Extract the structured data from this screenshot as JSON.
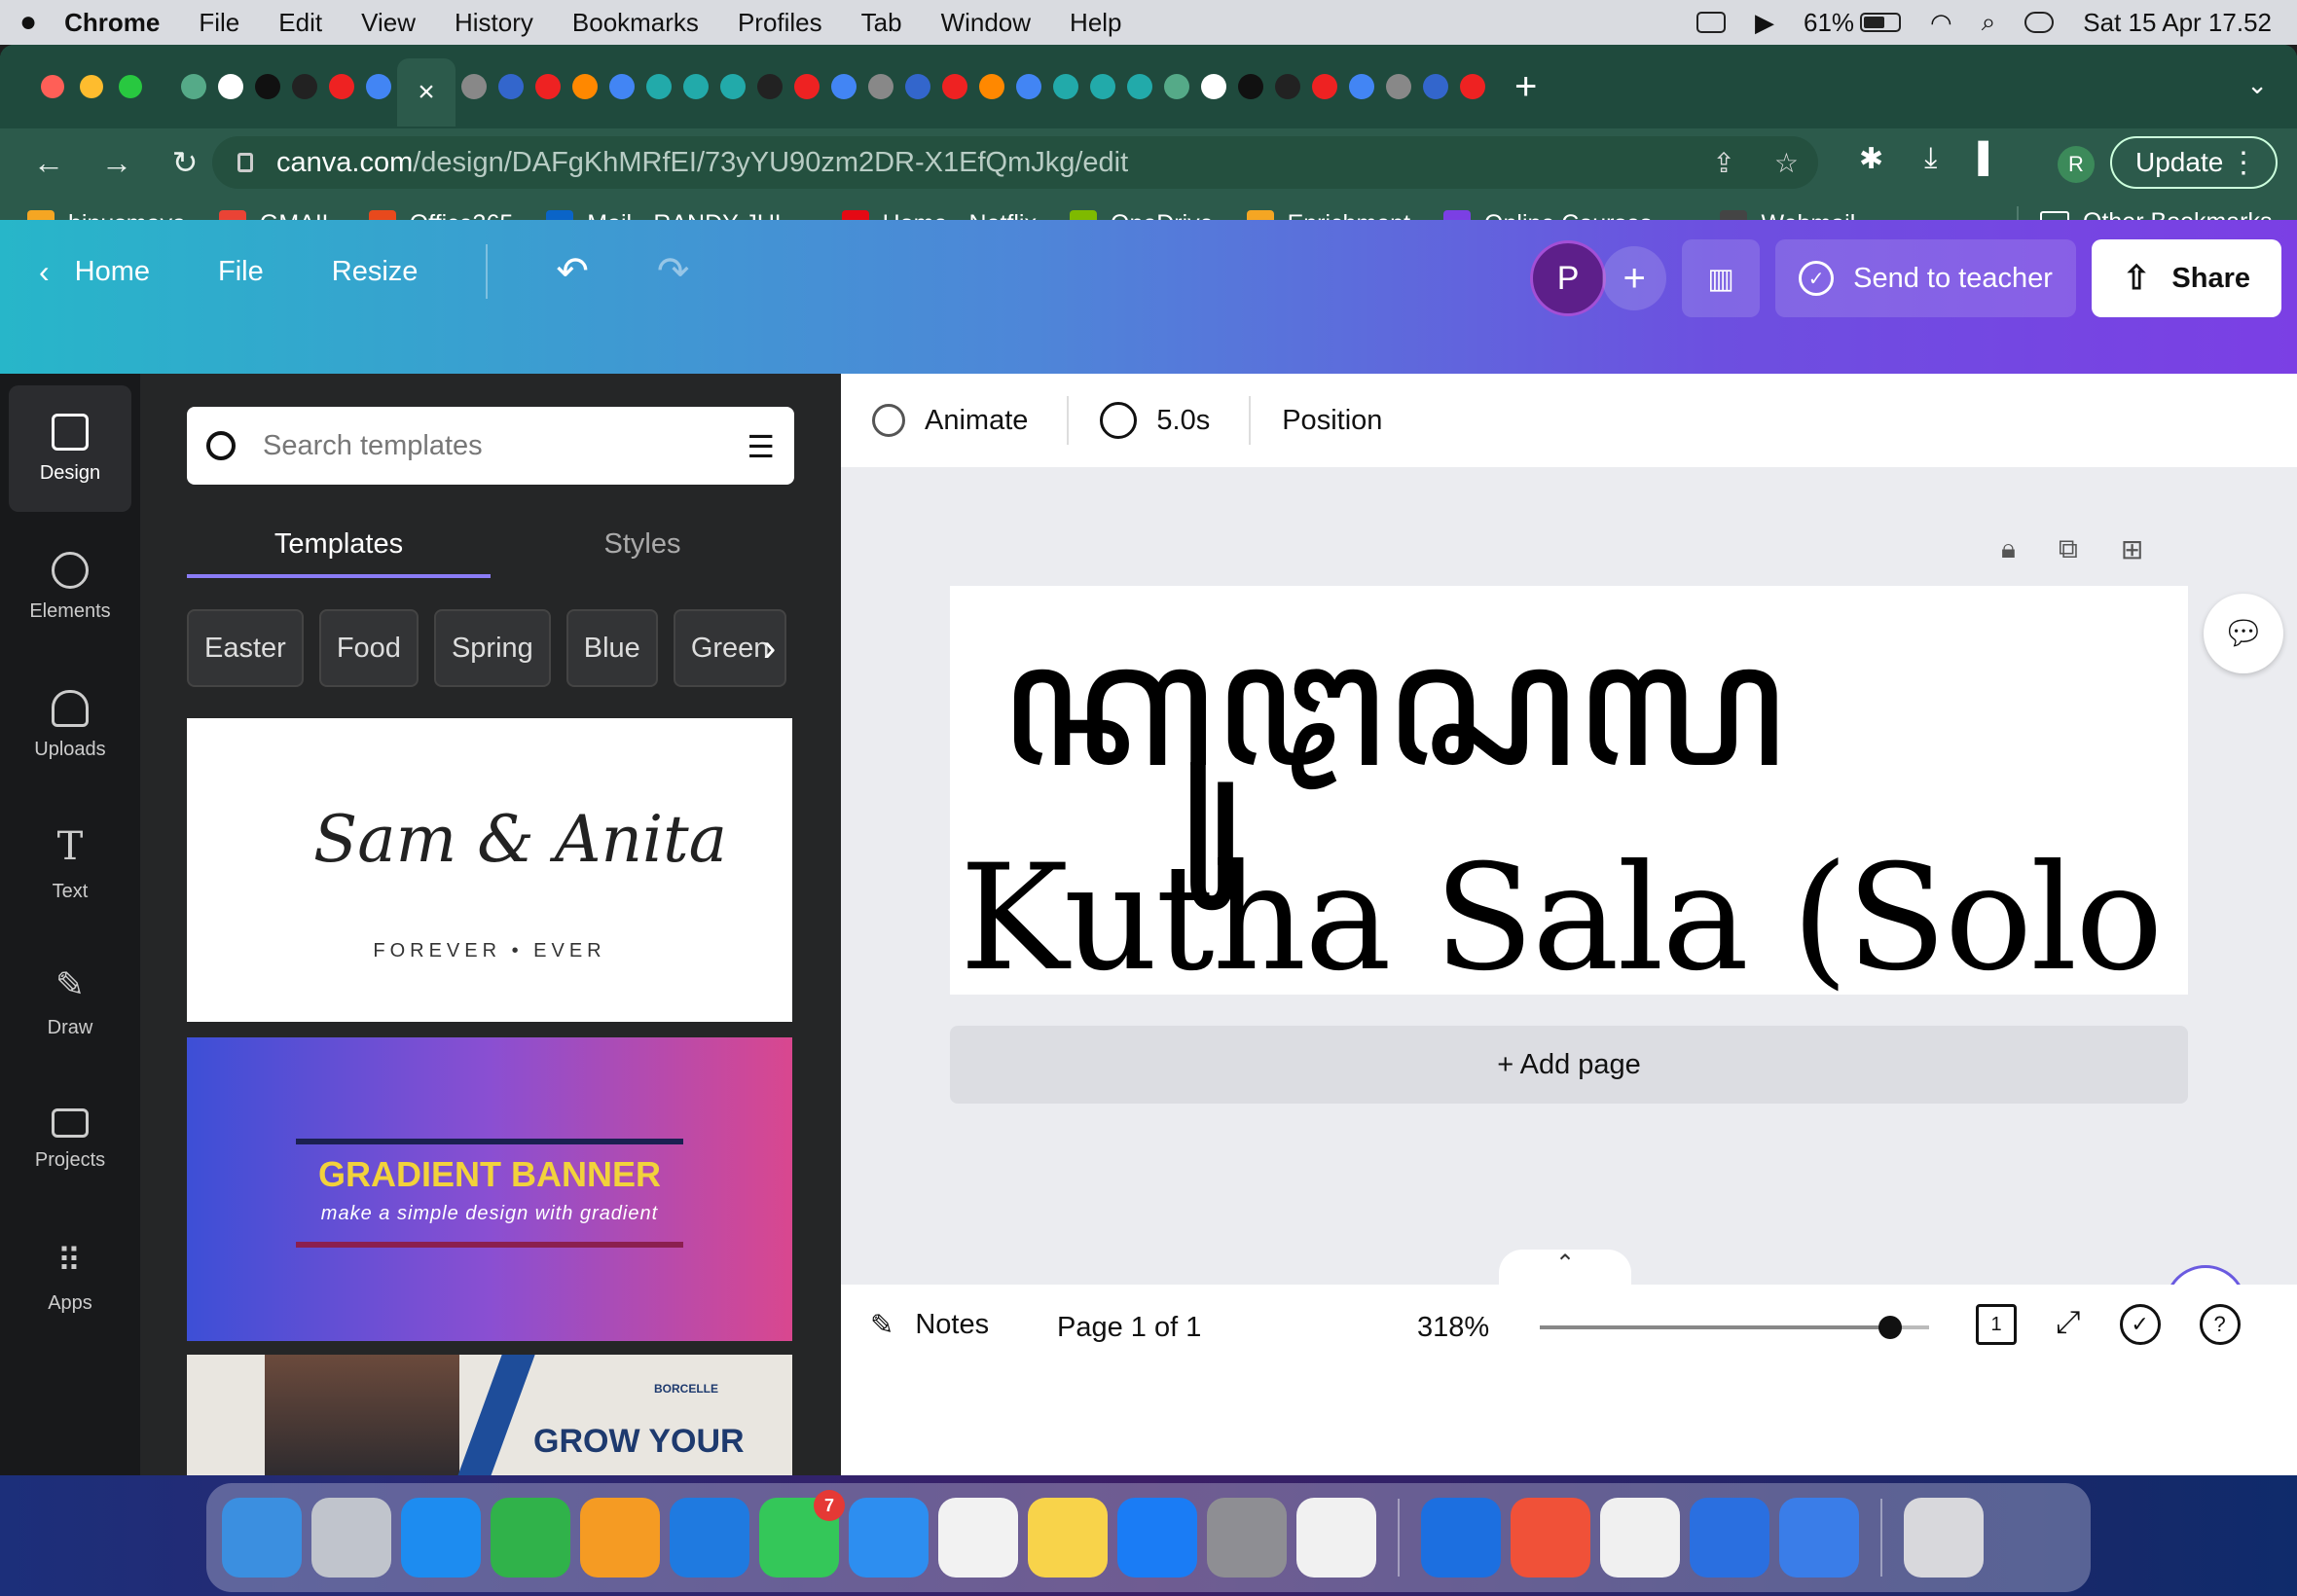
{
  "menubar": {
    "app_name": "Chrome",
    "items": [
      "File",
      "Edit",
      "View",
      "History",
      "Bookmarks",
      "Profiles",
      "Tab",
      "Window",
      "Help"
    ],
    "battery_percent": "61%",
    "battery_level": 0.61,
    "datetime": "Sat 15 Apr  17.52"
  },
  "browser": {
    "active_tab_close": "×",
    "new_tab": "+",
    "url_host": "canva.com",
    "url_path": "/design/DAFgKhMRfEI/73yYU90zm2DR-X1EfQmJkg/edit",
    "profile_initial": "R",
    "update_label": "Update",
    "favicons": [
      "#5a8",
      "#fff",
      "#111",
      "#222",
      "#e22",
      "#4285f4",
      "#888",
      "#36c",
      "#e22",
      "#f80",
      "#4285f4",
      "#2aa",
      "#2aa",
      "#2aa"
    ],
    "bookmarks": [
      {
        "label": "binusmaya",
        "color": "#f5a623"
      },
      {
        "label": "GMAIL",
        "color": "#ea4335"
      },
      {
        "label": "Office365",
        "color": "#e8491d"
      },
      {
        "label": "Mail - RANDY JUL...",
        "color": "#0a64c8"
      },
      {
        "label": "Home - Netflix",
        "color": "#e50914"
      },
      {
        "label": "OneDrive",
        "color": "#7fba00"
      },
      {
        "label": "Enrichment",
        "color": "#f5a623"
      },
      {
        "label": "Online Courses -...",
        "color": "#7b3fe4"
      },
      {
        "label": "Webmail",
        "color": "#444"
      }
    ],
    "bookmarks_more": "»",
    "other_bookmarks": "Other Bookmarks"
  },
  "canva": {
    "header": {
      "home": "Home",
      "file": "File",
      "resize": "Resize",
      "avatar_initial": "P",
      "send_to_teacher": "Send to teacher",
      "share": "Share"
    },
    "rail": [
      "Design",
      "Elements",
      "Uploads",
      "Text",
      "Draw",
      "Projects",
      "Apps"
    ],
    "panel": {
      "search_placeholder": "Search templates",
      "tabs": [
        "Templates",
        "Styles"
      ],
      "chips": [
        "Easter",
        "Food",
        "Spring",
        "Blue",
        "Green"
      ],
      "template1_script": "Sam & Anita",
      "template1_sub": "FOREVER • EVER",
      "template2_title": "GRADIENT BANNER",
      "template2_sub": "make a simple design with gradient",
      "template3_logo": "BORCELLE",
      "template3_title": "GROW YOUR"
    },
    "context": {
      "animate": "Animate",
      "duration": "5.0s",
      "position": "Position"
    },
    "page": {
      "javanese_text": "ꦏꦸꦛꦱꦭ",
      "latin_text": "Kutha Sala (Solo City)"
    },
    "add_page": "+ Add page",
    "footer": {
      "notes": "Notes",
      "page_indicator": "Page 1 of 1",
      "zoom": "318%",
      "zoom_slider": 0.9,
      "page_count_badge": "1"
    }
  },
  "dock": {
    "apps": [
      {
        "name": "finder-app",
        "color": "#3b8fe0"
      },
      {
        "name": "launchpad-app",
        "color": "#c0c4cc"
      },
      {
        "name": "safari-app",
        "color": "#1d8cf0"
      },
      {
        "name": "numbers-app",
        "color": "#30b24a"
      },
      {
        "name": "pages-app",
        "color": "#f59b23"
      },
      {
        "name": "keynote-app",
        "color": "#1f7ae0"
      },
      {
        "name": "messages-app",
        "color": "#34c759"
      },
      {
        "name": "mail-app",
        "color": "#2d8ef0"
      },
      {
        "name": "reminders-app",
        "color": "#f2f2f2"
      },
      {
        "name": "notes-app",
        "color": "#f8d34a"
      },
      {
        "name": "app-store-app",
        "color": "#1a7cf5"
      },
      {
        "name": "system-settings-app",
        "color": "#8e8e93"
      },
      {
        "name": "chrome-app",
        "color": "#f1f1f1"
      }
    ],
    "apps_right": [
      {
        "name": "xcode-app",
        "color": "#1c6fe0"
      },
      {
        "name": "swift-playgrounds-app",
        "color": "#f05138"
      },
      {
        "name": "photos-app",
        "color": "#f0f0f0"
      },
      {
        "name": "simulator-app",
        "color": "#2a6fe0"
      },
      {
        "name": "cat-app",
        "color": "#3a7de8"
      }
    ],
    "messages_badge": "7"
  }
}
